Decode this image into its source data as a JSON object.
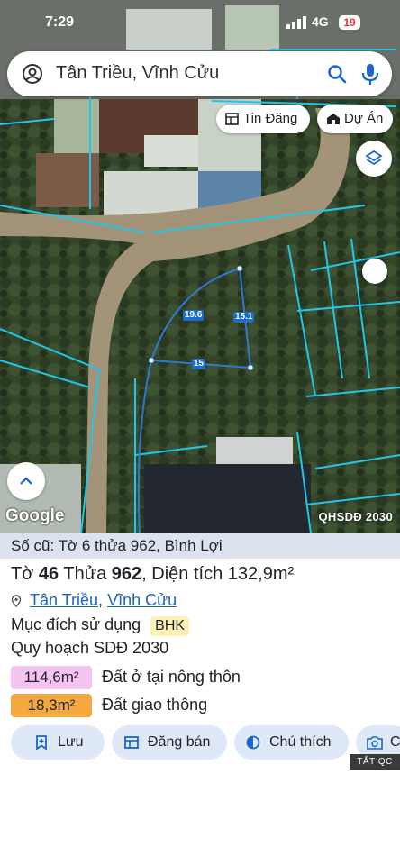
{
  "status_bar": {
    "time": "7:29",
    "network": "4G",
    "battery": "19"
  },
  "search": {
    "query": "Tân Triều, Vĩnh Cửu"
  },
  "chips": {
    "listing_label": "Tin Đăng",
    "project_label": "Dự Án"
  },
  "map": {
    "brand": "Google",
    "layer_label": "QHSDĐ 2030",
    "plot_edges": [
      "19.6",
      "15.1",
      "15"
    ]
  },
  "parcel": {
    "old_number": "Số cũ: Tờ 6 thửa 962, Bình Lợi",
    "sheet_label": "Tờ",
    "sheet_no": "46",
    "plot_label": "Thửa",
    "plot_no": "962",
    "area_label": "Diện tích",
    "area_value": "132,9m²",
    "commune": "Tân Triều",
    "district": "Vĩnh Cửu",
    "purpose_label": "Mục đích sử dụng",
    "purpose_code": "BHK",
    "plan_label": "Quy hoạch SDĐ 2030",
    "zones": [
      {
        "area": "114,6m²",
        "label": "Đất ở tại nông thôn",
        "color": "#f6c4f2"
      },
      {
        "area": "18,3m²",
        "label": "Đất giao thông",
        "color": "#f5a840"
      }
    ]
  },
  "actions": {
    "save": "Lưu",
    "post_sale": "Đăng bán",
    "legend": "Chú thích",
    "camera_partial": "C"
  },
  "ad_tag": "TẮT QC"
}
